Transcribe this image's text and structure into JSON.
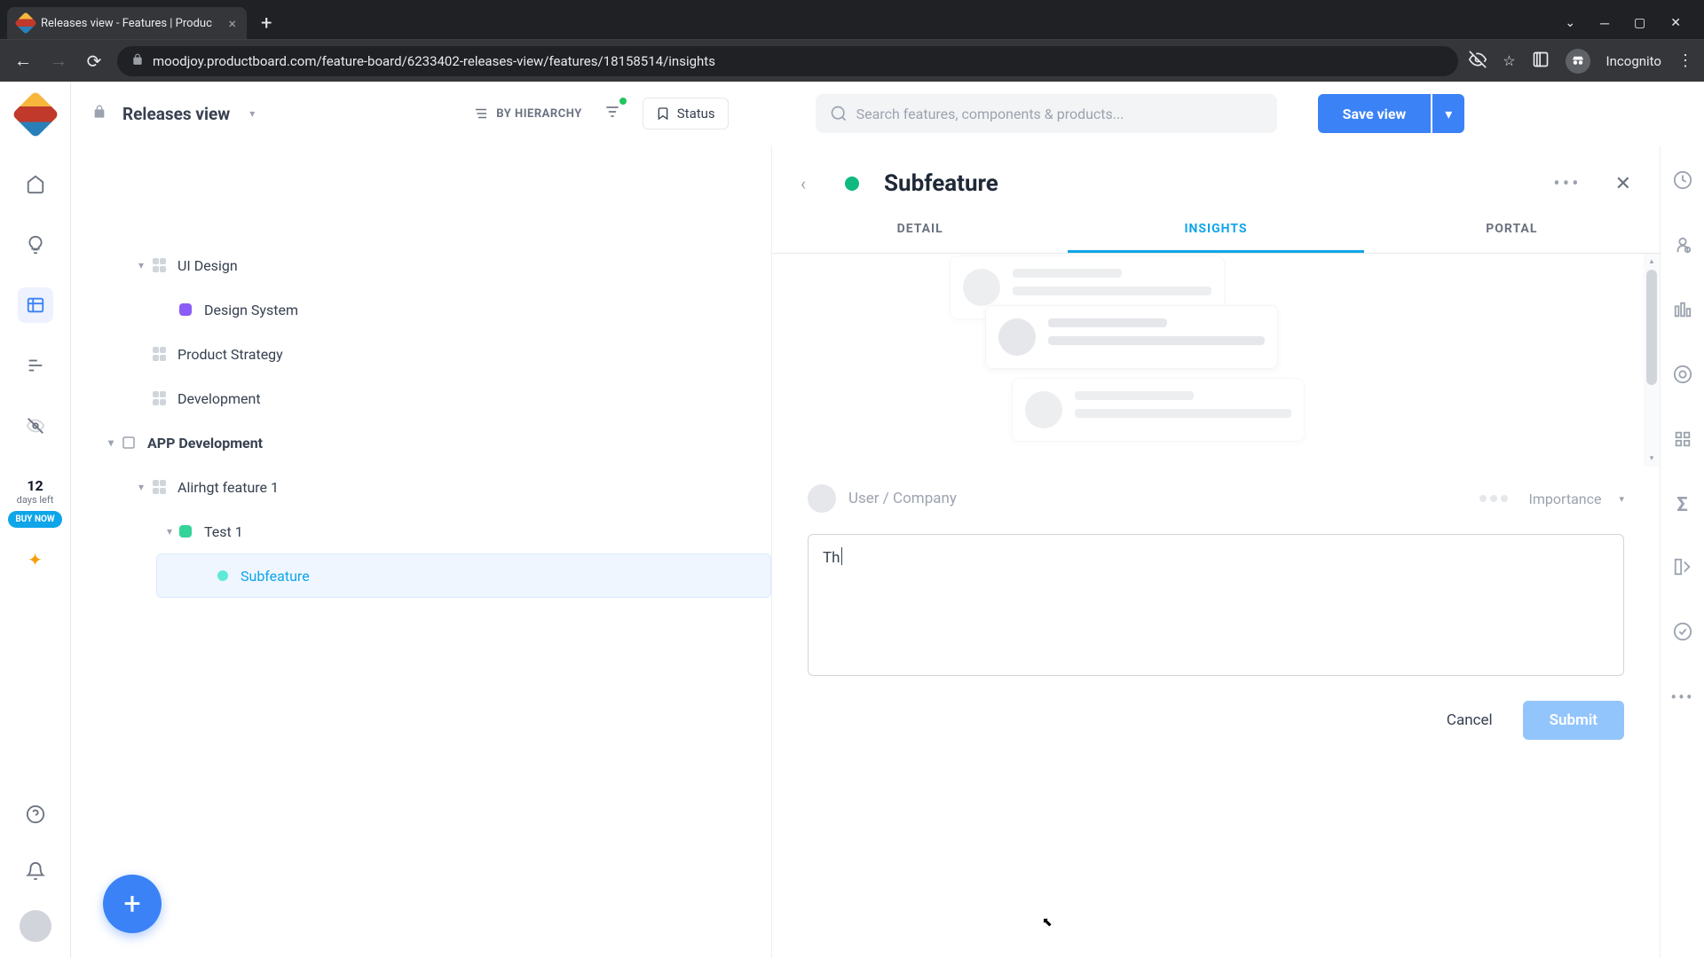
{
  "browser": {
    "tab_title": "Releases view - Features | Produc",
    "url": "moodjoy.productboard.com/feature-board/6233402-releases-view/features/18158514/insights",
    "incognito_label": "Incognito"
  },
  "topbar": {
    "view_name": "Releases view",
    "by_hierarchy": "BY HIERARCHY",
    "status_label": "Status",
    "search_placeholder": "Search features, components & products...",
    "save_label": "Save view"
  },
  "trial": {
    "days": "12",
    "days_label": "days left",
    "buy_label": "BUY NOW"
  },
  "tree": {
    "ui_design": "UI Design",
    "design_system": "Design System",
    "product_strategy": "Product Strategy",
    "development": "Development",
    "app_dev": "APP Development",
    "alirhgt": "Alirhgt feature 1",
    "test1": "Test 1",
    "subfeature": "Subfeature"
  },
  "panel": {
    "title": "Subfeature",
    "tabs": {
      "detail": "DETAIL",
      "insights": "INSIGHTS",
      "portal": "PORTAL"
    },
    "user_placeholder": "User / Company",
    "importance_label": "Importance",
    "note_value": "Th",
    "cancel": "Cancel",
    "submit": "Submit"
  },
  "colors": {
    "purple": "#8b5cf6",
    "teal": "#34d399",
    "teal_light": "#5eead4"
  }
}
